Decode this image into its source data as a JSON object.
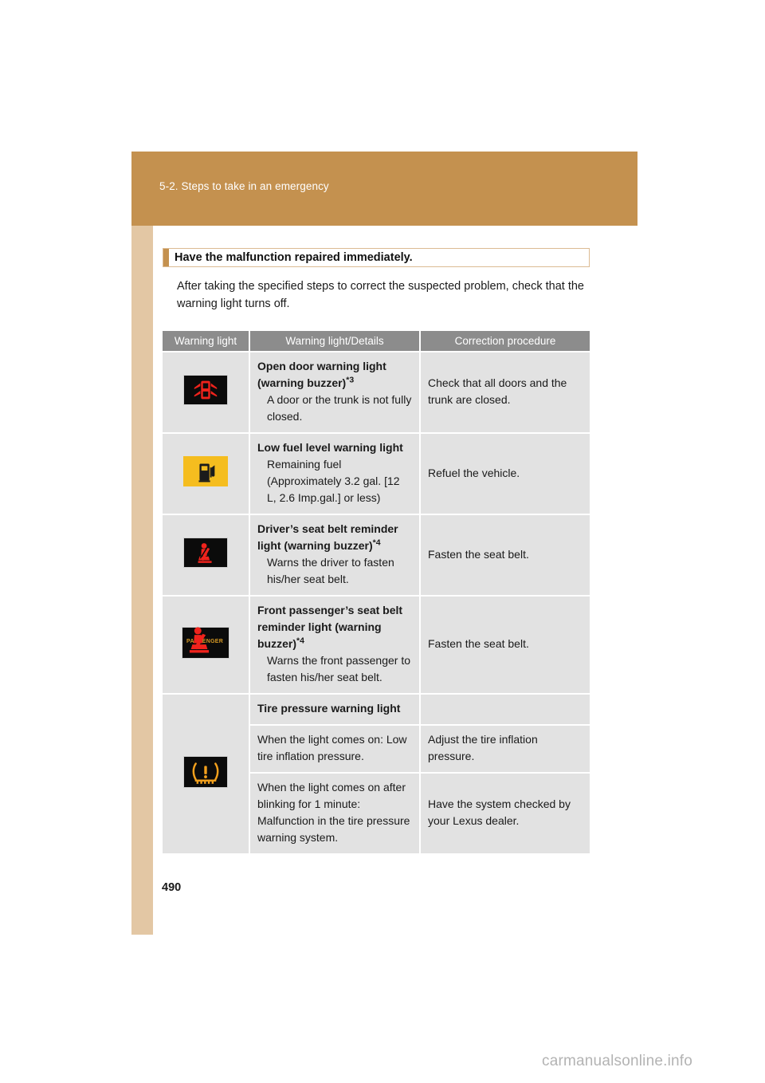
{
  "page": {
    "chapter_label": "5-2. Steps to take in an emergency",
    "page_number": "490",
    "watermark": "carmanualsonline.info",
    "band_color": "#c4914f",
    "strip_color": "#e3c7a4"
  },
  "section": {
    "title": "Have the malfunction repaired immediately.",
    "intro": "After taking the specified steps to correct the suspected problem, check that the warning light turns off."
  },
  "table": {
    "headers": {
      "col1": "Warning light",
      "col2": "Warning light/Details",
      "col3": "Correction procedure"
    },
    "rows": [
      {
        "icon_name": "open-door-warning-light-icon",
        "title": "Open door warning light (warning buzzer)",
        "footnote": "*3",
        "body": "A door or the trunk is not fully closed.",
        "fix": "Check that all doors and the trunk are closed."
      },
      {
        "icon_name": "low-fuel-level-warning-light-icon",
        "title": "Low fuel level warning light",
        "footnote": "",
        "body": "Remaining fuel (Approximately 3.2 gal. [12 L, 2.6 Imp.gal.] or less)",
        "fix": "Refuel the vehicle."
      },
      {
        "icon_name": "driver-seat-belt-reminder-light-icon",
        "title": "Driver’s seat belt reminder light (warning buzzer)",
        "footnote": "*4",
        "body": "Warns the driver to fasten his/her seat belt.",
        "fix": "Fasten the seat belt."
      },
      {
        "icon_name": "front-passenger-seat-belt-reminder-light-icon",
        "title": "Front passenger’s seat belt reminder light (warning buzzer)",
        "footnote": "*4",
        "body": "Warns the front passenger to fasten his/her seat belt.",
        "fix": "Fasten the seat belt.",
        "icon_text": "PASSENGER"
      }
    ],
    "tpms": {
      "icon_name": "tire-pressure-warning-light-icon",
      "title": "Tire pressure warning light",
      "sub_rows": [
        {
          "body": "When the light comes on: Low tire inflation pressure.",
          "fix": "Adjust the tire inflation pressure."
        },
        {
          "body": "When the light comes on after blinking for 1 minute: Malfunction in the tire pressure warning system.",
          "fix": "Have the system checked by your Lexus dealer."
        }
      ]
    }
  }
}
